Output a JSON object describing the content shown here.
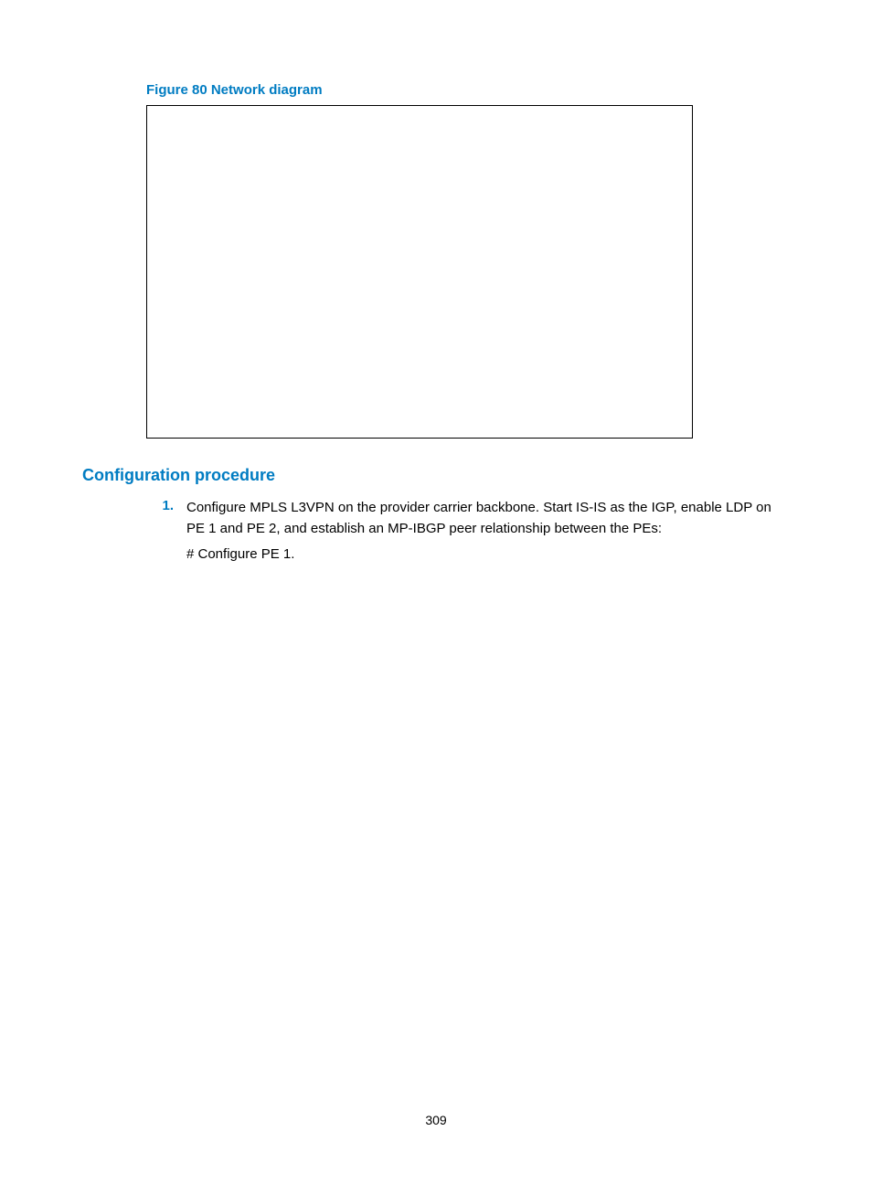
{
  "figure": {
    "caption": "Figure 80 Network diagram"
  },
  "section": {
    "heading": "Configuration procedure"
  },
  "steps": [
    {
      "number": "1.",
      "lines": [
        "Configure MPLS L3VPN on the provider carrier backbone. Start IS-IS as the IGP, enable LDP on PE 1 and PE 2, and establish an MP-IBGP peer relationship between the PEs:",
        "# Configure PE 1."
      ]
    }
  ],
  "pageNumber": "309"
}
